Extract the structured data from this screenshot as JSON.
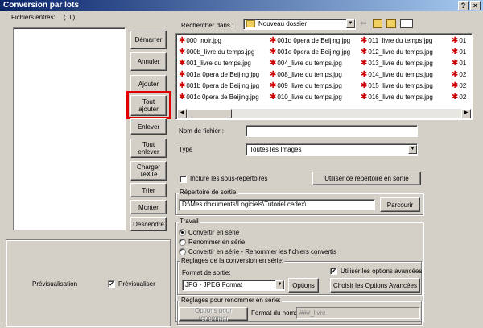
{
  "window": {
    "title": "Conversion par lots",
    "help_btn": "?",
    "close_btn": "×"
  },
  "left_panel": {
    "files_label": "Fichiers entrés:",
    "files_count": "( 0 )"
  },
  "buttons": {
    "start": "Démarrer",
    "cancel": "Annuler",
    "add": "Ajouter",
    "add_all": "Tout ajouter",
    "remove": "Enlever",
    "remove_all": "Tout enlever",
    "load": "Charger TeXTe",
    "sort": "Trier",
    "up": "Monter",
    "down": "Descendre"
  },
  "preview": {
    "label": "Prévisualisation",
    "checkbox_label": "Prévisualiser",
    "checked": true
  },
  "browser": {
    "search_label": "Rechercher dans :",
    "folder": "Nouveau dossier",
    "files": [
      [
        "000_noir.jpg",
        "000b_livre du temps.jpg",
        "001_livre du temps.jpg",
        "001a 0pera de Beijing.jpg",
        "001b 0pera de Beijing.jpg",
        "001c 0pera de Beijing.jpg"
      ],
      [
        "001d 0pera de Beijing.jpg",
        "001e 0pera de Beijing.jpg",
        "004_livre du temps.jpg",
        "008_livre du temps.jpg",
        "009_livre du temps.jpg",
        "010_livre du temps.jpg"
      ],
      [
        "011_livre du temps.jpg",
        "012_livre du temps.jpg",
        "013_livre du temps.jpg",
        "014_livre du temps.jpg",
        "015_livre du temps.jpg",
        "016_livre du temps.jpg"
      ],
      [
        "01",
        "01",
        "01",
        "02",
        "02",
        "02"
      ]
    ]
  },
  "filename": {
    "label": "Nom de fichier :",
    "value": ""
  },
  "type": {
    "label": "Type",
    "value": "Toutes les Images"
  },
  "subdirs": {
    "label": "Inclure les sous-répertoires",
    "checked": false
  },
  "use_dir_btn": "Utiliser ce répertoire en sortie",
  "output": {
    "label": "Répertoire de sortie:",
    "path": "D:\\Mes documents\\Logiciels\\Tutoriel cedex\\",
    "browse": "Parcourir"
  },
  "work": {
    "label": "Travail",
    "options": [
      "Convertir en série",
      "Renommer en série",
      "Convertir en série - Renommer les fichiers convertis"
    ],
    "selected": 0
  },
  "conversion": {
    "label": "Réglages de la conversion en série:",
    "format_label": "Format de sortie:",
    "advanced_label": "Utiliser les options avancées",
    "advanced_checked": true,
    "format_value": "JPG - JPEG Format",
    "options_btn": "Options",
    "advanced_btn": "Choisir les Options Avancées"
  },
  "rename": {
    "label": "Réglages pour renommer en série:",
    "options_btn": "Options pour renommer",
    "name_format_label": "Format du nom:",
    "name_format_value": "###_livre"
  },
  "colors": {
    "highlight": "#e00000",
    "title_start": "#0a246a",
    "title_end": "#a6caf0"
  }
}
